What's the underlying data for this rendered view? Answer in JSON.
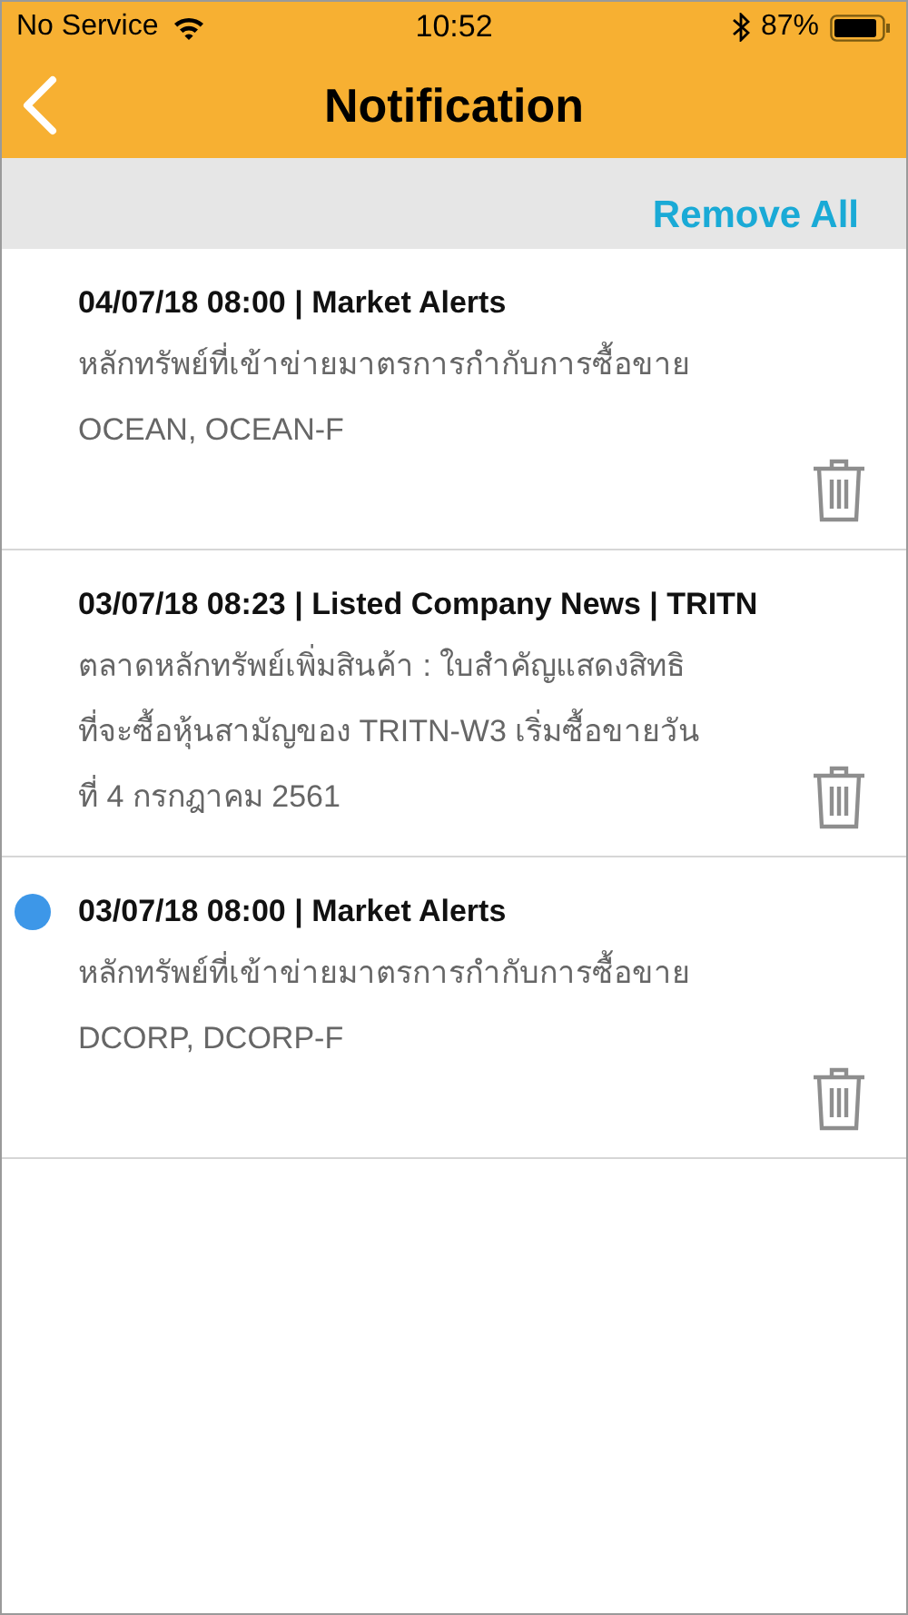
{
  "status_bar": {
    "carrier": "No Service",
    "time": "10:52",
    "battery": "87%"
  },
  "header": {
    "title": "Notification"
  },
  "toolbar": {
    "action": "Remove All"
  },
  "notifications": [
    {
      "title": "04/07/18 08:00 | Market Alerts",
      "lines": [
        "หลักทรัพย์ที่เข้าข่ายมาตรการกำกับการซื้อขาย",
        "OCEAN, OCEAN-F"
      ],
      "unread": false
    },
    {
      "title": "03/07/18 08:23 | Listed Company News | TRITN",
      "lines": [
        "ตลาดหลักทรัพย์เพิ่มสินค้า : ใบสำคัญแสดงสิทธิ",
        "ที่จะซื้อหุ้นสามัญของ TRITN-W3 เริ่มซื้อขายวัน",
        "ที่ 4 กรกฎาคม 2561"
      ],
      "unread": false
    },
    {
      "title": "03/07/18 08:00 | Market Alerts",
      "lines": [
        "หลักทรัพย์ที่เข้าข่ายมาตรการกำกับการซื้อขาย",
        "DCORP, DCORP-F"
      ],
      "unread": true
    }
  ]
}
